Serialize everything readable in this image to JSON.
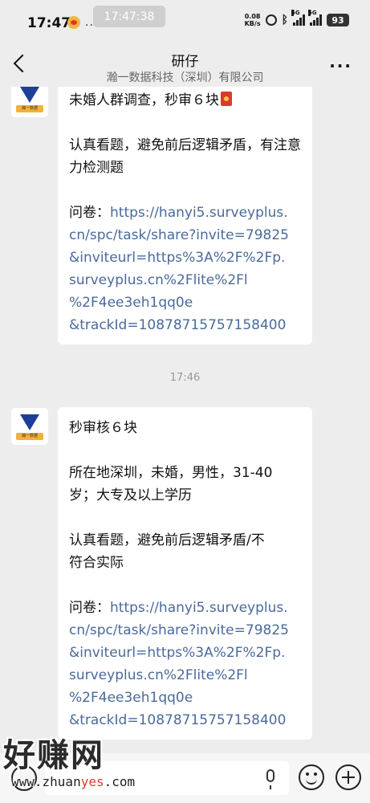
{
  "status_bar": {
    "time": "17:47",
    "more": "...",
    "screenshot_clock": "17:47:38",
    "net_speed_value": "0.08",
    "net_speed_unit": "KB/s",
    "signal1_label": "5G",
    "signal2_label": "5G",
    "battery": "93"
  },
  "header": {
    "title": "研仔",
    "subtitle": "瀚一数据科技（深圳）有限公司",
    "more": "···"
  },
  "messages": [
    {
      "lines": [
        "未婚人群调查，秒审６块",
        "",
        "认真看题，避免前后逻辑矛盾，有注意力检测题",
        "",
        "问卷："
      ],
      "link": "https://hanyi5.surveyplus.cn/spc/task/share?invite=79825&inviteurl=https%3A%2F%2Fp.surveyplus.cn%2Flite%2Fl%2F4ee3eh1qq0e&trackId=1087871575 7158400"
    },
    {
      "lines": [
        "秒审核６块",
        "",
        "所在地深圳，未婚，男性，31-40岁；大专及以上学历",
        "",
        "认真看题，避免前后逻辑矛盾/不符合实际",
        "",
        "问卷："
      ],
      "link": "https://hanyi5.surveyplus.cn/spc/task/share?invite=79825&inviteurl=https%3A%2F%2Fp.surveyplus.cn%2Flite%2Fl%2F4ee3eh1qq0e&trackId=1087871575 7158400"
    }
  ],
  "msg1": {
    "title": "未婚人群调查，秒审６块",
    "body": "认真看题，避免前后逻辑矛盾，有注意力检测题",
    "link_label": "问卷：",
    "link_lines": [
      "https://hanyi5.surveyplus.",
      "cn/spc/task/share?invite=79825",
      "&inviteurl=https%3A%2F%2Fp.",
      "surveyplus.cn%2Flite%2Fl",
      "%2F4ee3eh1qq0e",
      "&trackId=10878715757158400"
    ]
  },
  "timestamp": "17:46",
  "msg2": {
    "title": "秒审核６块",
    "req_line1": "所在地深圳，未婚，男性，31-40",
    "req_line2": "岁；大专及以上学历",
    "body_line1": "认真看题，避免前后逻辑矛盾/不",
    "body_line2": "符合实际",
    "link_label": "问卷：",
    "link_lines": [
      "https://hanyi5.surveyplus.",
      "cn/spc/task/share?invite=79825",
      "&inviteurl=https%3A%2F%2Fp.",
      "surveyplus.cn%2Flite%2Fl",
      "%2F4ee3eh1qq0e",
      "&trackId=10878715757158400"
    ]
  },
  "avatar_label": "瀚一数据",
  "watermark": {
    "cn": "好赚网",
    "url_a": "www.zhuan",
    "url_b": "yes",
    "url_c": ".com"
  }
}
